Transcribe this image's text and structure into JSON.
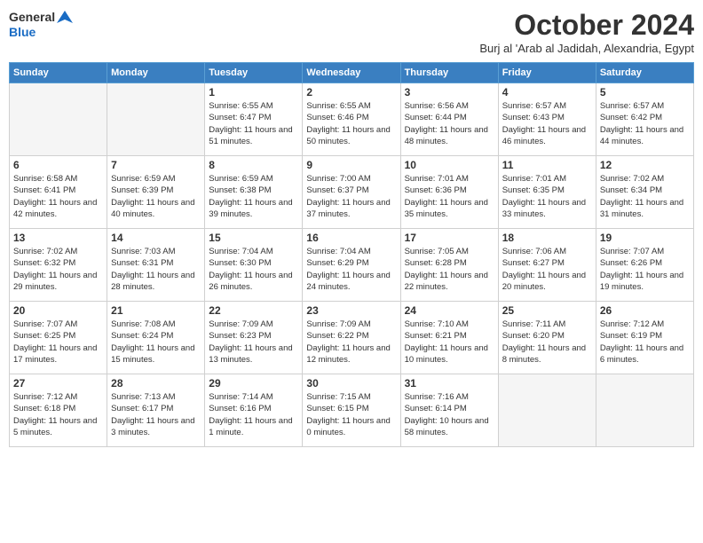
{
  "logo": {
    "line1": "General",
    "line2": "Blue"
  },
  "title": "October 2024",
  "location": "Burj al 'Arab al Jadidah, Alexandria, Egypt",
  "weekdays": [
    "Sunday",
    "Monday",
    "Tuesday",
    "Wednesday",
    "Thursday",
    "Friday",
    "Saturday"
  ],
  "weeks": [
    [
      {
        "day": "",
        "sunrise": "",
        "sunset": "",
        "daylight": "",
        "empty": true
      },
      {
        "day": "",
        "sunrise": "",
        "sunset": "",
        "daylight": "",
        "empty": true
      },
      {
        "day": "1",
        "sunrise": "Sunrise: 6:55 AM",
        "sunset": "Sunset: 6:47 PM",
        "daylight": "Daylight: 11 hours and 51 minutes."
      },
      {
        "day": "2",
        "sunrise": "Sunrise: 6:55 AM",
        "sunset": "Sunset: 6:46 PM",
        "daylight": "Daylight: 11 hours and 50 minutes."
      },
      {
        "day": "3",
        "sunrise": "Sunrise: 6:56 AM",
        "sunset": "Sunset: 6:44 PM",
        "daylight": "Daylight: 11 hours and 48 minutes."
      },
      {
        "day": "4",
        "sunrise": "Sunrise: 6:57 AM",
        "sunset": "Sunset: 6:43 PM",
        "daylight": "Daylight: 11 hours and 46 minutes."
      },
      {
        "day": "5",
        "sunrise": "Sunrise: 6:57 AM",
        "sunset": "Sunset: 6:42 PM",
        "daylight": "Daylight: 11 hours and 44 minutes."
      }
    ],
    [
      {
        "day": "6",
        "sunrise": "Sunrise: 6:58 AM",
        "sunset": "Sunset: 6:41 PM",
        "daylight": "Daylight: 11 hours and 42 minutes."
      },
      {
        "day": "7",
        "sunrise": "Sunrise: 6:59 AM",
        "sunset": "Sunset: 6:39 PM",
        "daylight": "Daylight: 11 hours and 40 minutes."
      },
      {
        "day": "8",
        "sunrise": "Sunrise: 6:59 AM",
        "sunset": "Sunset: 6:38 PM",
        "daylight": "Daylight: 11 hours and 39 minutes."
      },
      {
        "day": "9",
        "sunrise": "Sunrise: 7:00 AM",
        "sunset": "Sunset: 6:37 PM",
        "daylight": "Daylight: 11 hours and 37 minutes."
      },
      {
        "day": "10",
        "sunrise": "Sunrise: 7:01 AM",
        "sunset": "Sunset: 6:36 PM",
        "daylight": "Daylight: 11 hours and 35 minutes."
      },
      {
        "day": "11",
        "sunrise": "Sunrise: 7:01 AM",
        "sunset": "Sunset: 6:35 PM",
        "daylight": "Daylight: 11 hours and 33 minutes."
      },
      {
        "day": "12",
        "sunrise": "Sunrise: 7:02 AM",
        "sunset": "Sunset: 6:34 PM",
        "daylight": "Daylight: 11 hours and 31 minutes."
      }
    ],
    [
      {
        "day": "13",
        "sunrise": "Sunrise: 7:02 AM",
        "sunset": "Sunset: 6:32 PM",
        "daylight": "Daylight: 11 hours and 29 minutes."
      },
      {
        "day": "14",
        "sunrise": "Sunrise: 7:03 AM",
        "sunset": "Sunset: 6:31 PM",
        "daylight": "Daylight: 11 hours and 28 minutes."
      },
      {
        "day": "15",
        "sunrise": "Sunrise: 7:04 AM",
        "sunset": "Sunset: 6:30 PM",
        "daylight": "Daylight: 11 hours and 26 minutes."
      },
      {
        "day": "16",
        "sunrise": "Sunrise: 7:04 AM",
        "sunset": "Sunset: 6:29 PM",
        "daylight": "Daylight: 11 hours and 24 minutes."
      },
      {
        "day": "17",
        "sunrise": "Sunrise: 7:05 AM",
        "sunset": "Sunset: 6:28 PM",
        "daylight": "Daylight: 11 hours and 22 minutes."
      },
      {
        "day": "18",
        "sunrise": "Sunrise: 7:06 AM",
        "sunset": "Sunset: 6:27 PM",
        "daylight": "Daylight: 11 hours and 20 minutes."
      },
      {
        "day": "19",
        "sunrise": "Sunrise: 7:07 AM",
        "sunset": "Sunset: 6:26 PM",
        "daylight": "Daylight: 11 hours and 19 minutes."
      }
    ],
    [
      {
        "day": "20",
        "sunrise": "Sunrise: 7:07 AM",
        "sunset": "Sunset: 6:25 PM",
        "daylight": "Daylight: 11 hours and 17 minutes."
      },
      {
        "day": "21",
        "sunrise": "Sunrise: 7:08 AM",
        "sunset": "Sunset: 6:24 PM",
        "daylight": "Daylight: 11 hours and 15 minutes."
      },
      {
        "day": "22",
        "sunrise": "Sunrise: 7:09 AM",
        "sunset": "Sunset: 6:23 PM",
        "daylight": "Daylight: 11 hours and 13 minutes."
      },
      {
        "day": "23",
        "sunrise": "Sunrise: 7:09 AM",
        "sunset": "Sunset: 6:22 PM",
        "daylight": "Daylight: 11 hours and 12 minutes."
      },
      {
        "day": "24",
        "sunrise": "Sunrise: 7:10 AM",
        "sunset": "Sunset: 6:21 PM",
        "daylight": "Daylight: 11 hours and 10 minutes."
      },
      {
        "day": "25",
        "sunrise": "Sunrise: 7:11 AM",
        "sunset": "Sunset: 6:20 PM",
        "daylight": "Daylight: 11 hours and 8 minutes."
      },
      {
        "day": "26",
        "sunrise": "Sunrise: 7:12 AM",
        "sunset": "Sunset: 6:19 PM",
        "daylight": "Daylight: 11 hours and 6 minutes."
      }
    ],
    [
      {
        "day": "27",
        "sunrise": "Sunrise: 7:12 AM",
        "sunset": "Sunset: 6:18 PM",
        "daylight": "Daylight: 11 hours and 5 minutes."
      },
      {
        "day": "28",
        "sunrise": "Sunrise: 7:13 AM",
        "sunset": "Sunset: 6:17 PM",
        "daylight": "Daylight: 11 hours and 3 minutes."
      },
      {
        "day": "29",
        "sunrise": "Sunrise: 7:14 AM",
        "sunset": "Sunset: 6:16 PM",
        "daylight": "Daylight: 11 hours and 1 minute."
      },
      {
        "day": "30",
        "sunrise": "Sunrise: 7:15 AM",
        "sunset": "Sunset: 6:15 PM",
        "daylight": "Daylight: 11 hours and 0 minutes."
      },
      {
        "day": "31",
        "sunrise": "Sunrise: 7:16 AM",
        "sunset": "Sunset: 6:14 PM",
        "daylight": "Daylight: 10 hours and 58 minutes."
      },
      {
        "day": "",
        "sunrise": "",
        "sunset": "",
        "daylight": "",
        "empty": true
      },
      {
        "day": "",
        "sunrise": "",
        "sunset": "",
        "daylight": "",
        "empty": true
      }
    ]
  ]
}
